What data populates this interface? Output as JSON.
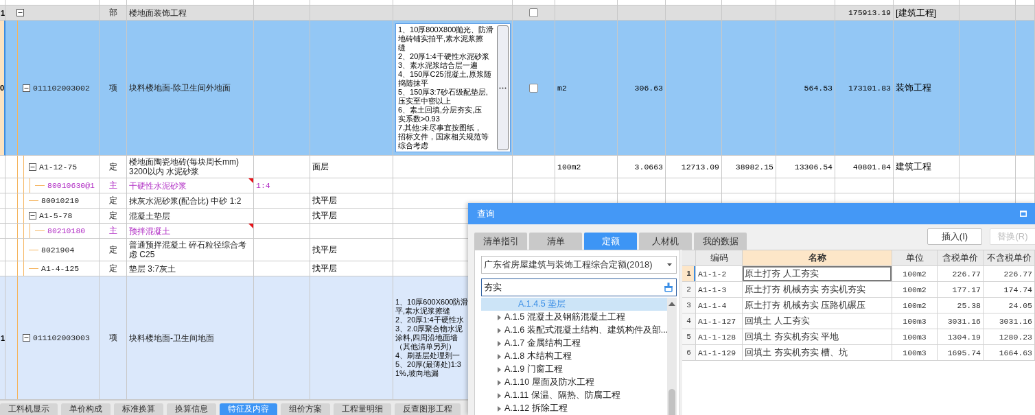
{
  "grid": {
    "rows": [
      {
        "kind": "section",
        "row_no": "1",
        "expanded": true,
        "type": "部",
        "name": "楼地面装饰工程",
        "checked": false,
        "column_13": "175913.19",
        "category": "[建筑工程]",
        "selected": false,
        "flagged": false,
        "children": [
          {
            "kind": "item",
            "row_no": "0",
            "code": "011102003002",
            "expanded": true,
            "type": "项",
            "name": "块料楼地面-除卫生间外地面",
            "editing": true,
            "features": [
              "1、10厚800X800抛光、防滑",
              "地砖铺实拍平,素水泥浆擦",
              "缝",
              "2、20厚1:4干硬性水泥砂浆",
              "3、素水泥浆结合层一遍",
              "4、150厚C25混凝土,原浆随",
              "捣随抹平",
              "5、150厚3:7砂石级配垫层,",
              "压实至中密以上",
              "6、素土回填,分层夯实,压",
              "实系数>0.93",
              "7.其他:未尽事宜按图纸，",
              "招标文件，国家相关规范等",
              "综合考虑"
            ],
            "checked": false,
            "unit": "m2",
            "quantity": "306.63",
            "column_12": "564.53",
            "column_13": "173101.83",
            "category": "装饰工程",
            "selected": true,
            "flagged": false,
            "children": [
              {
                "kind": "quota",
                "code": "A1-12-75",
                "expanded": true,
                "type": "定",
                "name": "楼地面陶瓷地砖(每块周长mm) 3200以内 水泥砂浆",
                "column_5": "面层",
                "unit": "100m2",
                "quantity": "3.0663",
                "column_10": "12713.09",
                "column_11": "38982.15",
                "column_12": "13306.54",
                "column_13": "40801.84",
                "category": "建筑工程",
                "selected": false,
                "flagged": false,
                "children": [
                  {
                    "kind": "material",
                    "code": "80010630@1",
                    "type": "主",
                    "name": "干硬性水泥砂浆",
                    "column_4": "1:4",
                    "selected": false,
                    "flagged": true
                  }
                ]
              },
              {
                "kind": "quota",
                "code": "80010210",
                "type": "定",
                "name": "抹灰水泥砂浆(配合比) 中砂 1:2",
                "column_5": "找平层",
                "selected": false,
                "flagged": false
              },
              {
                "kind": "quota",
                "code": "A1-5-78",
                "expanded": true,
                "type": "定",
                "name": "混凝土垫层",
                "column_5": "找平层",
                "selected": false,
                "flagged": false,
                "children": [
                  {
                    "kind": "material",
                    "code": "80210180",
                    "type": "主",
                    "name": "预拌混凝土",
                    "selected": false,
                    "flagged": true
                  }
                ]
              },
              {
                "kind": "quota",
                "code": "8021904",
                "type": "定",
                "name": "普通预拌混凝土 碎石粒径综合考虑 C25",
                "column_5": "找平层",
                "selected": false,
                "flagged": false
              },
              {
                "kind": "quota",
                "code": "A1-4-125",
                "type": "定",
                "name": "垫层 3:7灰土",
                "column_5": "找平层",
                "selected": false,
                "flagged": false
              }
            ]
          },
          {
            "kind": "item",
            "row_no": "1",
            "code": "011102003003",
            "expanded": true,
            "type": "项",
            "name": "块料楼地面-卫生间地面",
            "editing": false,
            "features": [
              "1、10厚600X600防滑",
              "平,素水泥浆擦缝",
              "2、20厚1:4干硬性水",
              "3、2.0厚聚合物水泥",
              "涂料,四周沿地面墙",
              "（其他清单另列）",
              "4、刷基层处理剂一",
              "5、20厚(最薄处)1:3",
              "1%,坡向地漏"
            ],
            "selected": false,
            "flagged": false
          }
        ]
      }
    ]
  },
  "bottom_tabs": [
    {
      "label": "工料机显示",
      "selected": false
    },
    {
      "label": "单价构成",
      "selected": false
    },
    {
      "label": "标准换算",
      "selected": false
    },
    {
      "label": "换算信息",
      "selected": false
    },
    {
      "label": "特征及内容",
      "selected": true
    },
    {
      "label": "组价方案",
      "selected": false
    },
    {
      "label": "工程量明细",
      "selected": false
    },
    {
      "label": "反查图形工程",
      "selected": false
    }
  ],
  "dialog": {
    "title": "查询",
    "tabs": [
      {
        "label": "清单指引",
        "selected": false
      },
      {
        "label": "清单",
        "selected": false
      },
      {
        "label": "定额",
        "selected": true
      },
      {
        "label": "人材机",
        "selected": false
      },
      {
        "label": "我的数据",
        "selected": false
      }
    ],
    "buttons": [
      {
        "label": "插入(I)",
        "disabled": false
      },
      {
        "label": "替换(R)",
        "disabled": true
      }
    ],
    "library": "广东省房屋建筑与装饰工程综合定额(2018)",
    "search": {
      "value": "夯实"
    },
    "tree": [
      {
        "children": [
          {
            "label": "A.1.4.5 垫层",
            "selected": true
          }
        ]
      },
      {
        "label": "A.1.5 混凝土及钢筋混凝土工程",
        "expanded": false,
        "selected": false
      },
      {
        "label": "A.1.6 装配式混凝土结构、建筑构件及部...",
        "expanded": false,
        "selected": false
      },
      {
        "label": "A.1.7 金属结构工程",
        "expanded": false,
        "selected": false
      },
      {
        "label": "A.1.8 木结构工程",
        "expanded": false,
        "selected": false
      },
      {
        "label": "A.1.9 门窗工程",
        "expanded": false,
        "selected": false
      },
      {
        "label": "A.1.10 屋面及防水工程",
        "expanded": false,
        "selected": false
      },
      {
        "label": "A.1.11 保温、隔热、防腐工程",
        "expanded": false,
        "selected": false
      },
      {
        "label": "A.1.12 拆除工程",
        "expanded": false,
        "selected": false
      }
    ],
    "columns": [
      {
        "label": "编码",
        "selected": false
      },
      {
        "label": "名称",
        "selected": true
      },
      {
        "label": "单位",
        "selected": false
      },
      {
        "label": "含税单价",
        "selected": false
      },
      {
        "label": "不含税单价",
        "selected": false
      }
    ],
    "rows": [
      {
        "no": "1",
        "code": "A1-1-2",
        "name": "原土打夯 人工夯实",
        "unit": "100m2",
        "price_with_tax": "226.77",
        "price_without_tax": "226.77",
        "selected": true
      },
      {
        "no": "2",
        "code": "A1-1-3",
        "name": "原土打夯 机械夯实 夯实机夯实",
        "unit": "100m2",
        "price_with_tax": "177.17",
        "price_without_tax": "174.74",
        "selected": false
      },
      {
        "no": "3",
        "code": "A1-1-4",
        "name": "原土打夯 机械夯实 压路机碾压",
        "unit": "100m2",
        "price_with_tax": "25.38",
        "price_without_tax": "24.05",
        "selected": false
      },
      {
        "no": "4",
        "code": "A1-1-127",
        "name": "回填土 人工夯实",
        "unit": "100m3",
        "price_with_tax": "3031.16",
        "price_without_tax": "3031.16",
        "selected": false
      },
      {
        "no": "5",
        "code": "A1-1-128",
        "name": "回填土 夯实机夯实 平地",
        "unit": "100m3",
        "price_with_tax": "1304.19",
        "price_without_tax": "1280.23",
        "selected": false
      },
      {
        "no": "6",
        "code": "A1-1-129",
        "name": "回填土 夯实机夯实 槽、坑",
        "unit": "100m3",
        "price_with_tax": "1695.74",
        "price_without_tax": "1664.63",
        "selected": false
      }
    ]
  }
}
